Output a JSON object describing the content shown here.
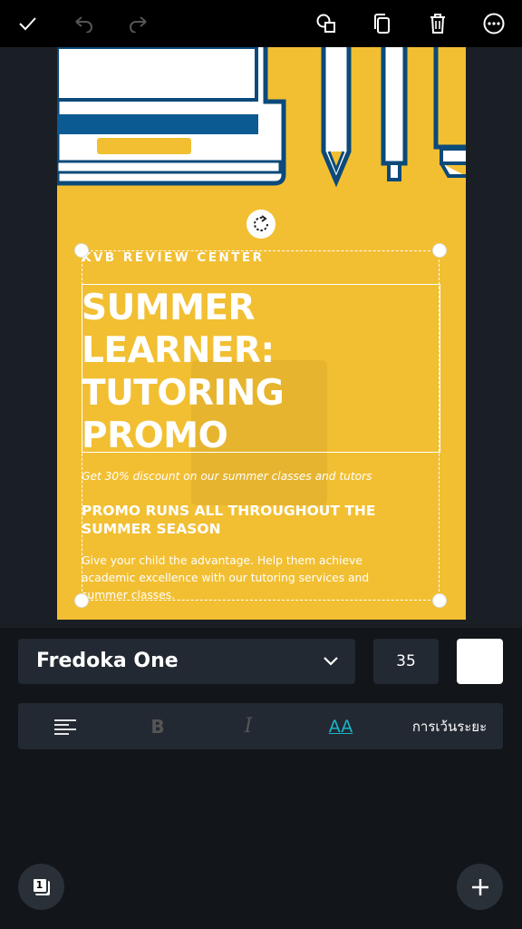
{
  "toolbar": {
    "confirm_icon": "check-icon",
    "undo_icon": "undo-icon",
    "redo_icon": "redo-icon",
    "shapes_icon": "shapes-icon",
    "duplicate_icon": "duplicate-icon",
    "delete_icon": "trash-icon",
    "more_icon": "more-icon"
  },
  "poster": {
    "background_color": "#f2bf32",
    "brand": "KVB REVIEW CENTER",
    "headline_lines": [
      "SUMMER",
      "LEARNER:",
      "TUTORING",
      "PROMO"
    ],
    "discount": "Get 30% discount on our summer classes and tutors",
    "promo_runs": "PROMO RUNS ALL THROUGHOUT THE SUMMER SEASON",
    "advantage": "Give your child the advantage. Help them achieve academic excellence with our tutoring services and summer classes."
  },
  "text_props": {
    "font_name": "Fredoka One",
    "font_size": "35",
    "color": "#ffffff"
  },
  "format_bar": {
    "align_icon": "align-left-icon",
    "bold_label": "B",
    "italic_label": "I",
    "case_label": "AA",
    "spacing_label": "การเว้นระยะ"
  },
  "bottom": {
    "page_count": "1",
    "add_icon": "plus-icon"
  }
}
